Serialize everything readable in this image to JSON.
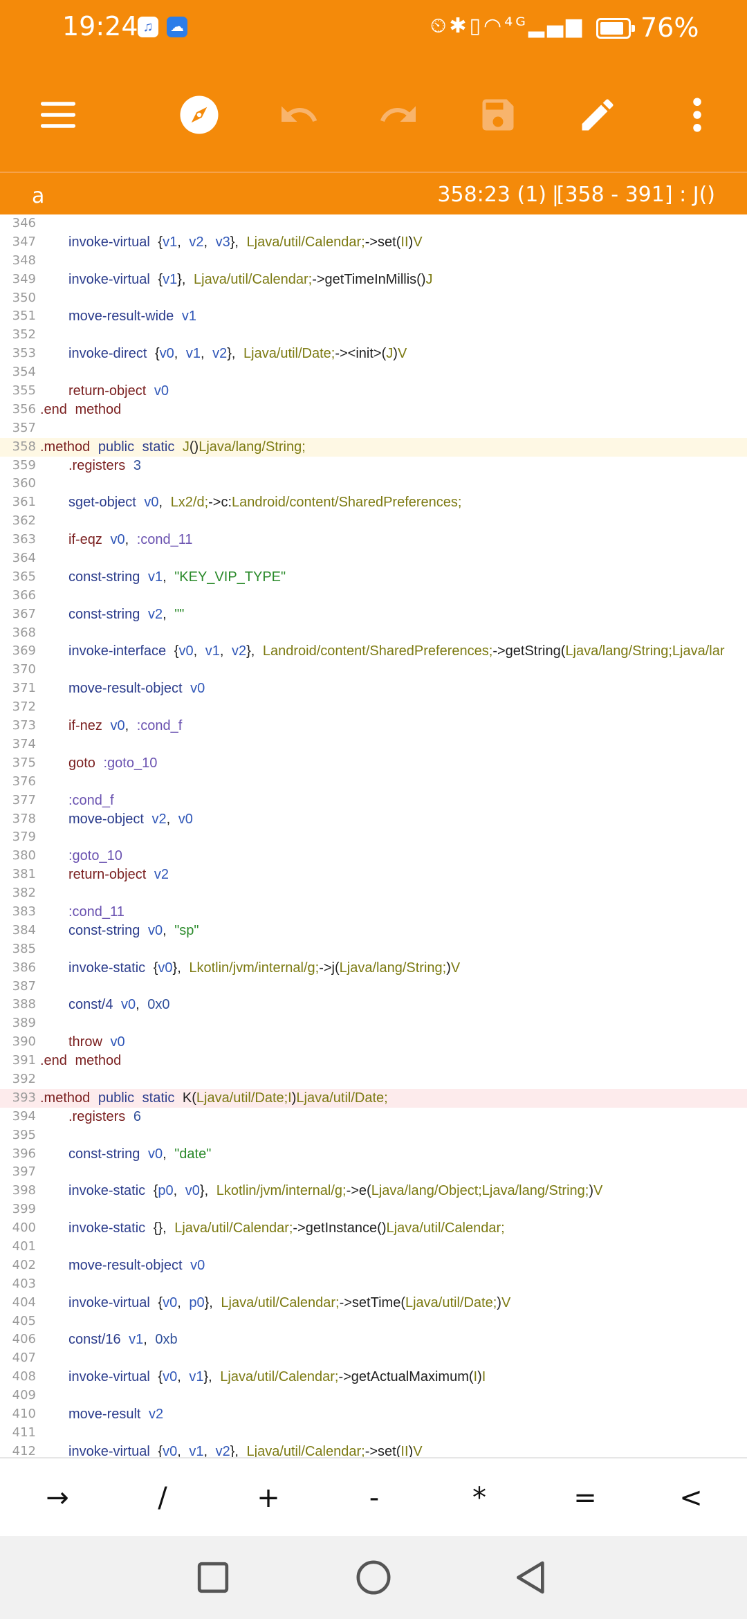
{
  "status_bar": {
    "time": "19:24",
    "icons": "⏲✱▯◠⁴ᴳ▂▄▆",
    "battery_pct": "76%",
    "battery_level": 0.76
  },
  "toolbar": {
    "menu_icon": "menu-icon",
    "navigate_icon": "compass-icon",
    "undo_icon": "undo-icon",
    "redo_icon": "redo-icon",
    "save_icon": "save-icon",
    "edit_icon": "pencil-icon",
    "more_icon": "more-vert-icon"
  },
  "info_bar": {
    "file": "a",
    "cursor": "358:23 (1)",
    "separator": "|",
    "range": "[358 - 391] : J()"
  },
  "editor": {
    "lines": [
      {
        "n": "346",
        "segs": []
      },
      {
        "n": "347",
        "indent": true,
        "segs": [
          [
            "kw-blue",
            "invoke-virtual "
          ],
          [
            "",
            "{"
          ],
          [
            "reg",
            "v1"
          ],
          [
            "",
            ", "
          ],
          [
            "reg",
            "v2"
          ],
          [
            "",
            ", "
          ],
          [
            "reg",
            "v3"
          ],
          [
            "",
            "}, "
          ],
          [
            "tp",
            "Ljava/util/Calendar;"
          ],
          [
            "",
            "->set("
          ],
          [
            "tp",
            "II"
          ],
          [
            "",
            ")"
          ],
          [
            "tp",
            "V"
          ]
        ]
      },
      {
        "n": "348",
        "segs": []
      },
      {
        "n": "349",
        "indent": true,
        "segs": [
          [
            "kw-blue",
            "invoke-virtual "
          ],
          [
            "",
            "{"
          ],
          [
            "reg",
            "v1"
          ],
          [
            "",
            "}, "
          ],
          [
            "tp",
            "Ljava/util/Calendar;"
          ],
          [
            "",
            "->getTimeInMillis()"
          ],
          [
            "tp",
            "J"
          ]
        ]
      },
      {
        "n": "350",
        "segs": []
      },
      {
        "n": "351",
        "indent": true,
        "segs": [
          [
            "kw-blue",
            "move-result-wide "
          ],
          [
            "reg",
            "v1"
          ]
        ]
      },
      {
        "n": "352",
        "segs": []
      },
      {
        "n": "353",
        "indent": true,
        "segs": [
          [
            "kw-blue",
            "invoke-direct "
          ],
          [
            "",
            "{"
          ],
          [
            "reg",
            "v0"
          ],
          [
            "",
            ", "
          ],
          [
            "reg",
            "v1"
          ],
          [
            "",
            ", "
          ],
          [
            "reg",
            "v2"
          ],
          [
            "",
            "}, "
          ],
          [
            "tp",
            "Ljava/util/Date;"
          ],
          [
            "",
            "-><init>("
          ],
          [
            "tp",
            "J"
          ],
          [
            "",
            ")"
          ],
          [
            "tp",
            "V"
          ]
        ]
      },
      {
        "n": "354",
        "segs": []
      },
      {
        "n": "355",
        "indent": true,
        "segs": [
          [
            "kw-dark",
            "return-object "
          ],
          [
            "reg",
            "v0"
          ]
        ]
      },
      {
        "n": "356",
        "segs": [
          [
            "kw-dark",
            ".end method"
          ]
        ]
      },
      {
        "n": "357",
        "segs": []
      },
      {
        "n": "358",
        "hl": "y",
        "segs": [
          [
            "kw-dark",
            ".method "
          ],
          [
            "kw-blue",
            "public static "
          ],
          [
            "tp",
            "J"
          ],
          [
            "",
            "()"
          ],
          [
            "tp",
            "Ljava/lang/String;"
          ]
        ]
      },
      {
        "n": "359",
        "indent": true,
        "segs": [
          [
            "kw-dark",
            ".registers "
          ],
          [
            "num",
            "3"
          ]
        ]
      },
      {
        "n": "360",
        "segs": []
      },
      {
        "n": "361",
        "indent": true,
        "segs": [
          [
            "kw-blue",
            "sget-object "
          ],
          [
            "reg",
            "v0"
          ],
          [
            "",
            ", "
          ],
          [
            "tp",
            "Lx2/d;"
          ],
          [
            "",
            "->c:"
          ],
          [
            "tp",
            "Landroid/content/SharedPreferences;"
          ]
        ]
      },
      {
        "n": "362",
        "segs": []
      },
      {
        "n": "363",
        "indent": true,
        "segs": [
          [
            "kw-dark",
            "if-eqz "
          ],
          [
            "reg",
            "v0"
          ],
          [
            "",
            ", "
          ],
          [
            "lbl",
            ":cond_11"
          ]
        ]
      },
      {
        "n": "364",
        "segs": []
      },
      {
        "n": "365",
        "indent": true,
        "segs": [
          [
            "kw-blue",
            "const-string "
          ],
          [
            "reg",
            "v1"
          ],
          [
            "",
            ", "
          ],
          [
            "str",
            "\"KEY_VIP_TYPE\""
          ]
        ]
      },
      {
        "n": "366",
        "segs": []
      },
      {
        "n": "367",
        "indent": true,
        "segs": [
          [
            "kw-blue",
            "const-string "
          ],
          [
            "reg",
            "v2"
          ],
          [
            "",
            ", "
          ],
          [
            "str",
            "\"\""
          ]
        ]
      },
      {
        "n": "368",
        "segs": []
      },
      {
        "n": "369",
        "indent": true,
        "segs": [
          [
            "kw-blue",
            "invoke-interface "
          ],
          [
            "",
            "{"
          ],
          [
            "reg",
            "v0"
          ],
          [
            "",
            ", "
          ],
          [
            "reg",
            "v1"
          ],
          [
            "",
            ", "
          ],
          [
            "reg",
            "v2"
          ],
          [
            "",
            "}, "
          ],
          [
            "tp",
            "Landroid/content/SharedPreferences;"
          ],
          [
            "",
            "->getString("
          ],
          [
            "tp",
            "Ljava/lang/String;Ljava/lar"
          ]
        ]
      },
      {
        "n": "370",
        "segs": []
      },
      {
        "n": "371",
        "indent": true,
        "segs": [
          [
            "kw-blue",
            "move-result-object "
          ],
          [
            "reg",
            "v0"
          ]
        ]
      },
      {
        "n": "372",
        "segs": []
      },
      {
        "n": "373",
        "indent": true,
        "segs": [
          [
            "kw-dark",
            "if-nez "
          ],
          [
            "reg",
            "v0"
          ],
          [
            "",
            ", "
          ],
          [
            "lbl",
            ":cond_f"
          ]
        ]
      },
      {
        "n": "374",
        "segs": []
      },
      {
        "n": "375",
        "indent": true,
        "segs": [
          [
            "kw-dark",
            "goto "
          ],
          [
            "lbl",
            ":goto_10"
          ]
        ]
      },
      {
        "n": "376",
        "segs": []
      },
      {
        "n": "377",
        "indent": true,
        "segs": [
          [
            "lbl",
            ":cond_f"
          ]
        ]
      },
      {
        "n": "378",
        "indent": true,
        "segs": [
          [
            "kw-blue",
            "move-object "
          ],
          [
            "reg",
            "v2"
          ],
          [
            "",
            ", "
          ],
          [
            "reg",
            "v0"
          ]
        ]
      },
      {
        "n": "379",
        "segs": []
      },
      {
        "n": "380",
        "indent": true,
        "segs": [
          [
            "lbl",
            ":goto_10"
          ]
        ]
      },
      {
        "n": "381",
        "indent": true,
        "segs": [
          [
            "kw-dark",
            "return-object "
          ],
          [
            "reg",
            "v2"
          ]
        ]
      },
      {
        "n": "382",
        "segs": []
      },
      {
        "n": "383",
        "indent": true,
        "segs": [
          [
            "lbl",
            ":cond_11"
          ]
        ]
      },
      {
        "n": "384",
        "indent": true,
        "segs": [
          [
            "kw-blue",
            "const-string "
          ],
          [
            "reg",
            "v0"
          ],
          [
            "",
            ", "
          ],
          [
            "str",
            "\"sp\""
          ]
        ]
      },
      {
        "n": "385",
        "segs": []
      },
      {
        "n": "386",
        "indent": true,
        "segs": [
          [
            "kw-blue",
            "invoke-static "
          ],
          [
            "",
            "{"
          ],
          [
            "reg",
            "v0"
          ],
          [
            "",
            "}, "
          ],
          [
            "tp",
            "Lkotlin/jvm/internal/g;"
          ],
          [
            "",
            "->j("
          ],
          [
            "tp",
            "Ljava/lang/String;"
          ],
          [
            "",
            ")"
          ],
          [
            "tp",
            "V"
          ]
        ]
      },
      {
        "n": "387",
        "segs": []
      },
      {
        "n": "388",
        "indent": true,
        "segs": [
          [
            "kw-blue",
            "const/4 "
          ],
          [
            "reg",
            "v0"
          ],
          [
            "",
            ", "
          ],
          [
            "num",
            "0x0"
          ]
        ]
      },
      {
        "n": "389",
        "segs": []
      },
      {
        "n": "390",
        "indent": true,
        "segs": [
          [
            "kw-dark",
            "throw "
          ],
          [
            "reg",
            "v0"
          ]
        ]
      },
      {
        "n": "391",
        "segs": [
          [
            "kw-dark",
            ".end method"
          ]
        ]
      },
      {
        "n": "392",
        "segs": []
      },
      {
        "n": "393",
        "hl": "r",
        "segs": [
          [
            "kw-dark",
            ".method "
          ],
          [
            "kw-blue",
            "public static "
          ],
          [
            "",
            "K("
          ],
          [
            "tp",
            "Ljava/util/Date;I"
          ],
          [
            "",
            ")"
          ],
          [
            "tp",
            "Ljava/util/Date;"
          ]
        ]
      },
      {
        "n": "394",
        "indent": true,
        "segs": [
          [
            "kw-dark",
            ".registers "
          ],
          [
            "num",
            "6"
          ]
        ]
      },
      {
        "n": "395",
        "segs": []
      },
      {
        "n": "396",
        "indent": true,
        "segs": [
          [
            "kw-blue",
            "const-string "
          ],
          [
            "reg",
            "v0"
          ],
          [
            "",
            ", "
          ],
          [
            "str",
            "\"date\""
          ]
        ]
      },
      {
        "n": "397",
        "segs": []
      },
      {
        "n": "398",
        "indent": true,
        "segs": [
          [
            "kw-blue",
            "invoke-static "
          ],
          [
            "",
            "{"
          ],
          [
            "reg",
            "p0"
          ],
          [
            "",
            ", "
          ],
          [
            "reg",
            "v0"
          ],
          [
            "",
            "}, "
          ],
          [
            "tp",
            "Lkotlin/jvm/internal/g;"
          ],
          [
            "",
            "->e("
          ],
          [
            "tp",
            "Ljava/lang/Object;Ljava/lang/String;"
          ],
          [
            "",
            ")"
          ],
          [
            "tp",
            "V"
          ]
        ]
      },
      {
        "n": "399",
        "segs": []
      },
      {
        "n": "400",
        "indent": true,
        "segs": [
          [
            "kw-blue",
            "invoke-static "
          ],
          [
            "",
            "{}, "
          ],
          [
            "tp",
            "Ljava/util/Calendar;"
          ],
          [
            "",
            "->getInstance()"
          ],
          [
            "tp",
            "Ljava/util/Calendar;"
          ]
        ]
      },
      {
        "n": "401",
        "segs": []
      },
      {
        "n": "402",
        "indent": true,
        "segs": [
          [
            "kw-blue",
            "move-result-object "
          ],
          [
            "reg",
            "v0"
          ]
        ]
      },
      {
        "n": "403",
        "segs": []
      },
      {
        "n": "404",
        "indent": true,
        "segs": [
          [
            "kw-blue",
            "invoke-virtual "
          ],
          [
            "",
            "{"
          ],
          [
            "reg",
            "v0"
          ],
          [
            "",
            ", "
          ],
          [
            "reg",
            "p0"
          ],
          [
            "",
            "}, "
          ],
          [
            "tp",
            "Ljava/util/Calendar;"
          ],
          [
            "",
            "->setTime("
          ],
          [
            "tp",
            "Ljava/util/Date;"
          ],
          [
            "",
            ")"
          ],
          [
            "tp",
            "V"
          ]
        ]
      },
      {
        "n": "405",
        "segs": []
      },
      {
        "n": "406",
        "indent": true,
        "segs": [
          [
            "kw-blue",
            "const/16 "
          ],
          [
            "reg",
            "v1"
          ],
          [
            "",
            ", "
          ],
          [
            "num",
            "0xb"
          ]
        ]
      },
      {
        "n": "407",
        "segs": []
      },
      {
        "n": "408",
        "indent": true,
        "segs": [
          [
            "kw-blue",
            "invoke-virtual "
          ],
          [
            "",
            "{"
          ],
          [
            "reg",
            "v0"
          ],
          [
            "",
            ", "
          ],
          [
            "reg",
            "v1"
          ],
          [
            "",
            "}, "
          ],
          [
            "tp",
            "Ljava/util/Calendar;"
          ],
          [
            "",
            "->getActualMaximum("
          ],
          [
            "tp",
            "I"
          ],
          [
            "",
            ")"
          ],
          [
            "tp",
            "I"
          ]
        ]
      },
      {
        "n": "409",
        "segs": []
      },
      {
        "n": "410",
        "indent": true,
        "segs": [
          [
            "kw-blue",
            "move-result "
          ],
          [
            "reg",
            "v2"
          ]
        ]
      },
      {
        "n": "411",
        "segs": []
      },
      {
        "n": "412",
        "indent": true,
        "segs": [
          [
            "kw-blue",
            "invoke-virtual "
          ],
          [
            "",
            "{"
          ],
          [
            "reg",
            "v0"
          ],
          [
            "",
            ", "
          ],
          [
            "reg",
            "v1"
          ],
          [
            "",
            ", "
          ],
          [
            "reg",
            "v2"
          ],
          [
            "",
            "}, "
          ],
          [
            "tp",
            "Ljava/util/Calendar;"
          ],
          [
            "",
            "->set("
          ],
          [
            "tp",
            "II"
          ],
          [
            "",
            ")"
          ],
          [
            "tp",
            "V"
          ]
        ]
      }
    ]
  },
  "keys": [
    "→",
    "/",
    "+",
    "-",
    "*",
    "=",
    "<"
  ],
  "nav": {
    "recent_icon": "square-icon",
    "home_icon": "circle-icon",
    "back_icon": "triangle-back-icon"
  }
}
